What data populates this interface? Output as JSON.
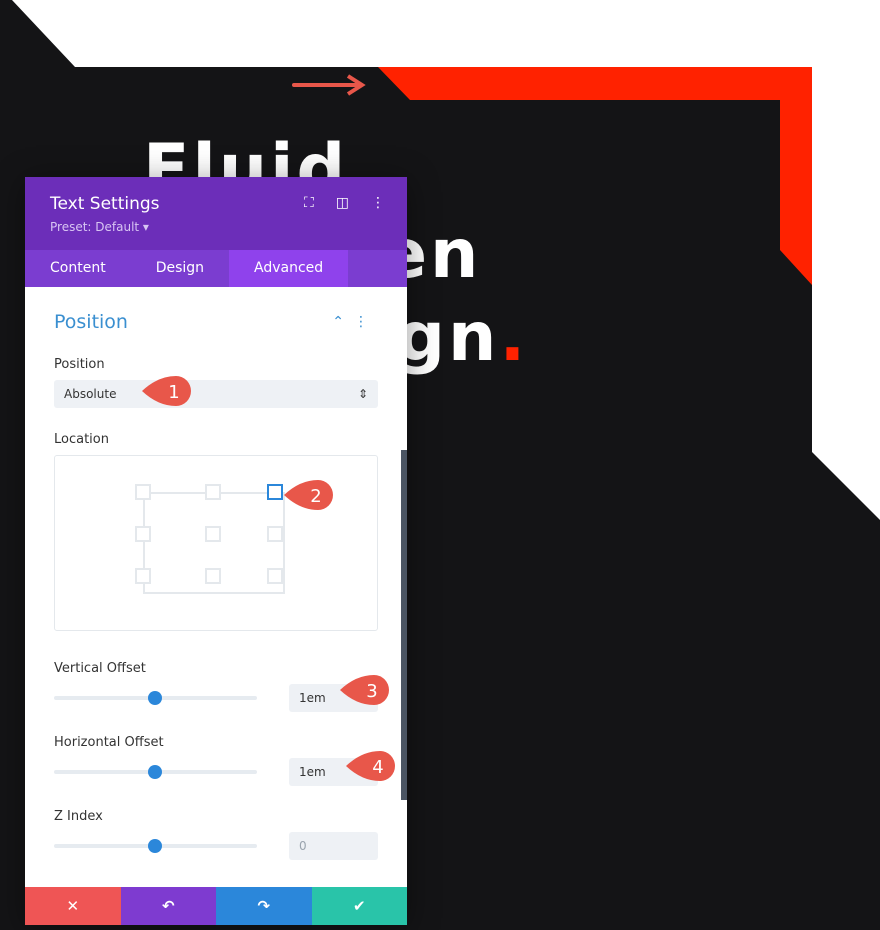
{
  "headline": {
    "line1": "Fluid",
    "line2": "Screen",
    "line3": "Design",
    "dot": "."
  },
  "colors": {
    "accent_red": "#ff2200",
    "header": "#6c2eb9",
    "tabs": "#7b3dd0",
    "active_tab": "#8f42ec",
    "link": "#3a8fd0",
    "slider": "#2b87da",
    "marker": "#e8574a"
  },
  "panel": {
    "title": "Text Settings",
    "preset": "Preset: Default ▾",
    "icons": [
      "focus-icon",
      "split-view-icon",
      "more-icon"
    ],
    "tabs": [
      {
        "label": "Content"
      },
      {
        "label": "Design"
      },
      {
        "label": "Advanced",
        "active": true
      }
    ],
    "section": {
      "title": "Position",
      "collapse": "⌃",
      "menu": "⋮"
    },
    "position": {
      "label": "Position",
      "value": "Absolute",
      "arrows": "⇕"
    },
    "location": {
      "label": "Location",
      "selected": "top-right"
    },
    "vertical": {
      "label": "Vertical Offset",
      "value": "1em",
      "slider": 50
    },
    "horizontal": {
      "label": "Horizontal Offset",
      "value": "1em",
      "slider": 50
    },
    "zindex": {
      "label": "Z Index",
      "placeholder": "0",
      "slider": 50
    },
    "footer": {
      "cancel": "✕",
      "undo": "↶",
      "redo": "↷",
      "save": "✔"
    }
  },
  "markers": [
    "1",
    "2",
    "3",
    "4"
  ]
}
